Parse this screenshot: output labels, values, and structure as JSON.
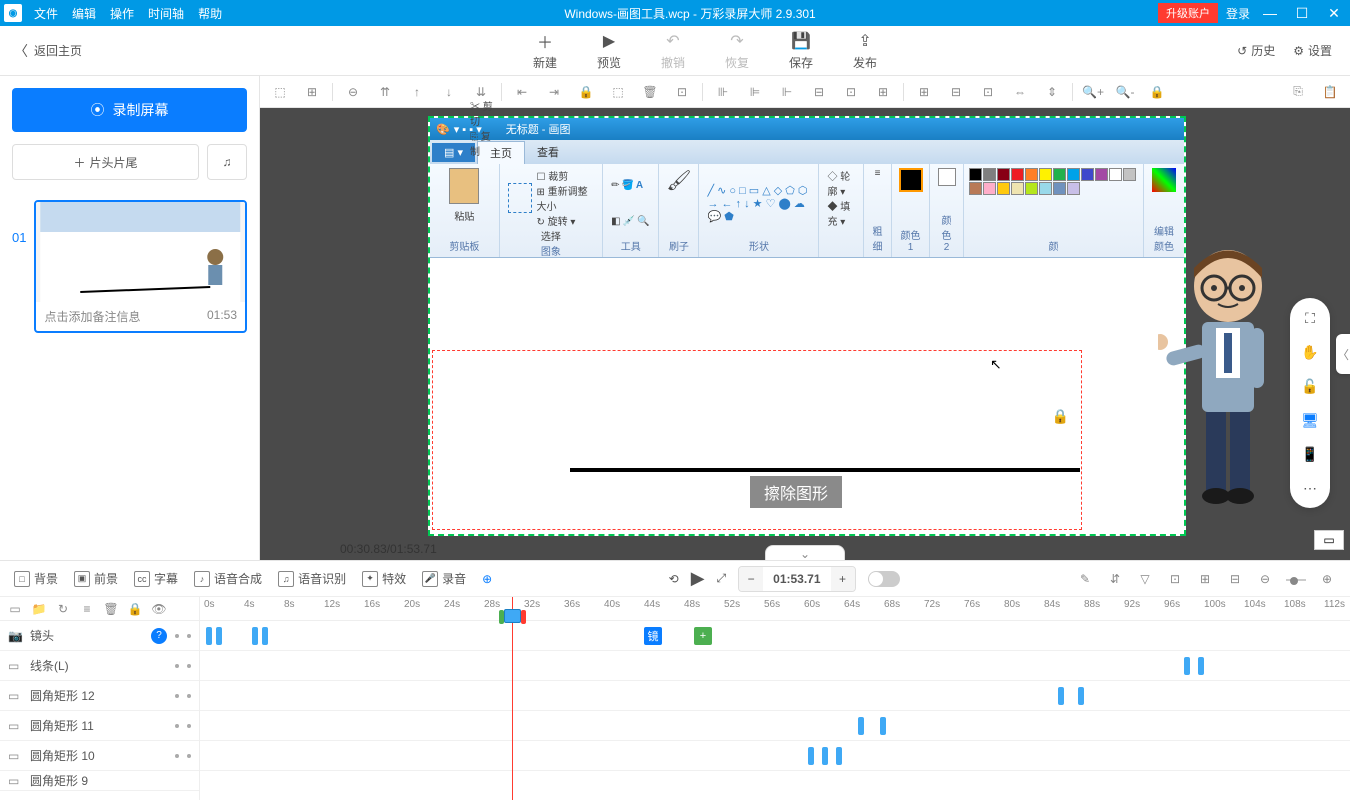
{
  "titlebar": {
    "menus": [
      "文件",
      "编辑",
      "操作",
      "时间轴",
      "帮助"
    ],
    "title": "Windows-画图工具.wcp - 万彩录屏大师 2.9.301",
    "upgrade": "升级账户",
    "login": "登录"
  },
  "toolbar": {
    "back": "返回主页",
    "actions": [
      {
        "icon": "＋",
        "label": "新建"
      },
      {
        "icon": "▶",
        "label": "预览"
      },
      {
        "icon": "↶",
        "label": "撤销",
        "disabled": true
      },
      {
        "icon": "↷",
        "label": "恢复",
        "disabled": true
      },
      {
        "icon": "💾",
        "label": "保存"
      },
      {
        "icon": "⇪",
        "label": "发布"
      }
    ],
    "history": "历史",
    "settings": "设置"
  },
  "left": {
    "record": "录制屏幕",
    "head_tail": "片头片尾",
    "scene_num": "01",
    "scene_note": "点击添加备注信息",
    "scene_time": "01:53"
  },
  "canvas": {
    "paint_title": "无标题 - 画图",
    "tab_home": "主页",
    "tab_view": "查看",
    "clip_cut": "剪切",
    "clip_copy": "复制",
    "paste": "粘贴",
    "clipboard": "剪贴板",
    "crop": "裁剪",
    "resize": "重新调整大小",
    "rotate": "旋转",
    "select": "选择",
    "image": "图象",
    "tools": "工具",
    "brush": "刷子",
    "shapes": "形状",
    "outline": "轮廓",
    "fill": "填充",
    "thickness": "粗细",
    "color1": "颜色 1",
    "color2": "颜色 2",
    "colors": "颜",
    "edit_colors": "编辑颜色",
    "erase_label": "擦除图形",
    "time_display": "00:30.83/01:53.71"
  },
  "timeline": {
    "tools": [
      {
        "ic": "□",
        "label": "背景"
      },
      {
        "ic": "▣",
        "label": "前景"
      },
      {
        "ic": "cc",
        "label": "字幕"
      },
      {
        "ic": "♪",
        "label": "语音合成"
      },
      {
        "ic": "♫",
        "label": "语音识别"
      },
      {
        "ic": "✦",
        "label": "特效"
      },
      {
        "ic": "🎤",
        "label": "录音"
      }
    ],
    "time_value": "01:53.71",
    "tracks": [
      {
        "name": "镜头",
        "help": true
      },
      {
        "name": "线条(L)"
      },
      {
        "name": "圆角矩形 12"
      },
      {
        "name": "圆角矩形 11"
      },
      {
        "name": "圆角矩形 10"
      },
      {
        "name": "圆角矩形 9"
      }
    ],
    "ticks": [
      "0s",
      "4s",
      "8s",
      "12s",
      "16s",
      "20s",
      "24s",
      "28s",
      "32s",
      "36s",
      "40s",
      "44s",
      "48s",
      "52s",
      "56s",
      "60s",
      "64s",
      "68s",
      "72s",
      "76s",
      "80s",
      "84s",
      "88s",
      "92s",
      "96s",
      "100s",
      "104s",
      "108s",
      "112s"
    ],
    "lens_marker": "镜"
  }
}
